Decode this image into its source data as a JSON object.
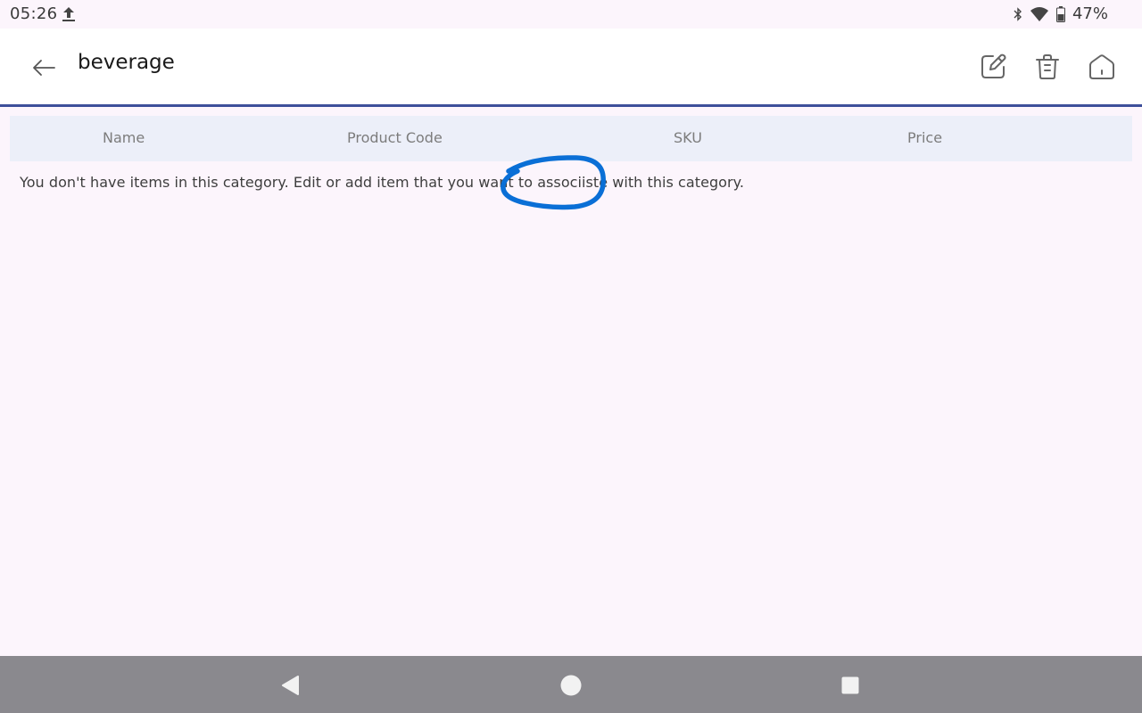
{
  "status_bar": {
    "time": "05:26",
    "battery": "47%",
    "icons": [
      "upload-icon",
      "bluetooth-icon",
      "wifi-icon",
      "battery-icon"
    ]
  },
  "app_bar": {
    "title": "beverage",
    "back_icon": "arrow-left-icon",
    "actions": [
      {
        "name": "edit-button",
        "icon": "edit-icon"
      },
      {
        "name": "delete-button",
        "icon": "trash-icon"
      },
      {
        "name": "home-button",
        "icon": "home-icon"
      }
    ],
    "accent_color": "#3d4f9a"
  },
  "table": {
    "columns": [
      "Name",
      "Product Code",
      "SKU",
      "Price"
    ],
    "header_bg": "#eceff9"
  },
  "empty_message": "You don't have items in this category. Edit or add item that you want to associiste with this category.",
  "annotation": {
    "type": "hand-drawn circle",
    "color": "#0a6fd6"
  },
  "nav_bar": {
    "buttons": [
      "back-triangle-icon",
      "home-circle-icon",
      "recents-square-icon"
    ]
  }
}
